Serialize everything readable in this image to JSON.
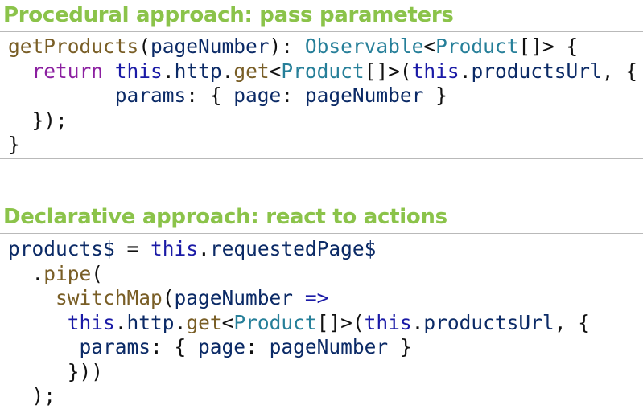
{
  "procedural": {
    "title": "Procedural approach: pass parameters",
    "lines": [
      {
        "indent": "",
        "tokens": [
          {
            "t": "getProducts",
            "c": "fn"
          },
          {
            "t": "(",
            "c": "punc"
          },
          {
            "t": "pageNumber",
            "c": "id"
          },
          {
            "t": "): ",
            "c": "punc"
          },
          {
            "t": "Observable",
            "c": "type"
          },
          {
            "t": "<",
            "c": "punc"
          },
          {
            "t": "Product",
            "c": "type"
          },
          {
            "t": "[]> {",
            "c": "punc"
          }
        ]
      },
      {
        "indent": "  ",
        "tokens": [
          {
            "t": "return",
            "c": "kw"
          },
          {
            "t": " ",
            "c": "punc"
          },
          {
            "t": "this",
            "c": "this"
          },
          {
            "t": ".",
            "c": "punc"
          },
          {
            "t": "http",
            "c": "id"
          },
          {
            "t": ".",
            "c": "punc"
          },
          {
            "t": "get",
            "c": "fn"
          },
          {
            "t": "<",
            "c": "punc"
          },
          {
            "t": "Product",
            "c": "type"
          },
          {
            "t": "[]>(",
            "c": "punc"
          },
          {
            "t": "this",
            "c": "this"
          },
          {
            "t": ".",
            "c": "punc"
          },
          {
            "t": "productsUrl",
            "c": "id"
          },
          {
            "t": ", {",
            "c": "punc"
          }
        ]
      },
      {
        "indent": "         ",
        "tokens": [
          {
            "t": "params",
            "c": "id"
          },
          {
            "t": ": { ",
            "c": "punc"
          },
          {
            "t": "page",
            "c": "id"
          },
          {
            "t": ": ",
            "c": "punc"
          },
          {
            "t": "pageNumber",
            "c": "id"
          },
          {
            "t": " }",
            "c": "punc"
          }
        ]
      },
      {
        "indent": "  ",
        "tokens": [
          {
            "t": "});",
            "c": "punc"
          }
        ]
      },
      {
        "indent": "",
        "tokens": [
          {
            "t": "}",
            "c": "punc"
          }
        ]
      }
    ]
  },
  "declarative": {
    "title": "Declarative approach: react to actions",
    "lines": [
      {
        "indent": "",
        "tokens": [
          {
            "t": "products$",
            "c": "id"
          },
          {
            "t": " = ",
            "c": "punc"
          },
          {
            "t": "this",
            "c": "this"
          },
          {
            "t": ".",
            "c": "punc"
          },
          {
            "t": "requestedPage$",
            "c": "id"
          }
        ]
      },
      {
        "indent": "  ",
        "tokens": [
          {
            "t": ".",
            "c": "punc"
          },
          {
            "t": "pipe",
            "c": "fn"
          },
          {
            "t": "(",
            "c": "punc"
          }
        ]
      },
      {
        "indent": "    ",
        "tokens": [
          {
            "t": "switchMap",
            "c": "fn"
          },
          {
            "t": "(",
            "c": "punc"
          },
          {
            "t": "pageNumber",
            "c": "id"
          },
          {
            "t": " ",
            "c": "punc"
          },
          {
            "t": "=>",
            "c": "op"
          }
        ]
      },
      {
        "indent": "     ",
        "tokens": [
          {
            "t": "this",
            "c": "this"
          },
          {
            "t": ".",
            "c": "punc"
          },
          {
            "t": "http",
            "c": "id"
          },
          {
            "t": ".",
            "c": "punc"
          },
          {
            "t": "get",
            "c": "fn"
          },
          {
            "t": "<",
            "c": "punc"
          },
          {
            "t": "Product",
            "c": "type"
          },
          {
            "t": "[]>(",
            "c": "punc"
          },
          {
            "t": "this",
            "c": "this"
          },
          {
            "t": ".",
            "c": "punc"
          },
          {
            "t": "productsUrl",
            "c": "id"
          },
          {
            "t": ", {",
            "c": "punc"
          }
        ]
      },
      {
        "indent": "      ",
        "tokens": [
          {
            "t": "params",
            "c": "id"
          },
          {
            "t": ": { ",
            "c": "punc"
          },
          {
            "t": "page",
            "c": "id"
          },
          {
            "t": ": ",
            "c": "punc"
          },
          {
            "t": "pageNumber",
            "c": "id"
          },
          {
            "t": " }",
            "c": "punc"
          }
        ]
      },
      {
        "indent": "     ",
        "tokens": [
          {
            "t": "}))",
            "c": "punc"
          }
        ]
      },
      {
        "indent": "  ",
        "tokens": [
          {
            "t": ");",
            "c": "punc"
          }
        ]
      }
    ]
  },
  "colors": {
    "title": "#8bc34a",
    "rule": "#b9b9b9"
  }
}
